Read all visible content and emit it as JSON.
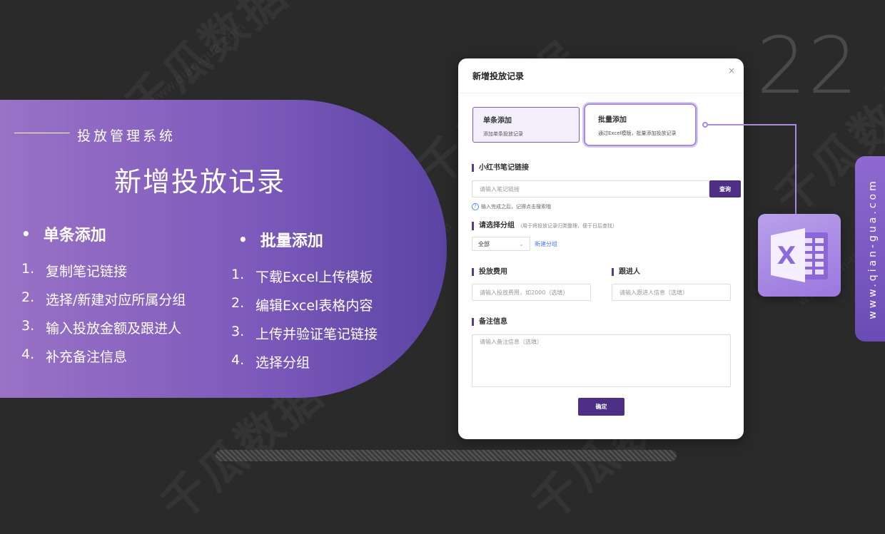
{
  "page_number": "22",
  "watermark": {
    "text": "千瓜数据",
    "url": "www.qian-gua.com"
  },
  "side_tab": {
    "text": "www.qian-gua.com"
  },
  "hero": {
    "subtitle": "投放管理系统",
    "title": "新增投放记录",
    "single": {
      "heading": "单条添加",
      "steps": [
        {
          "n": "1.",
          "text": "复制笔记链接"
        },
        {
          "n": "2.",
          "text": "选择/新建对应所属分组"
        },
        {
          "n": "3.",
          "text": "输入投放金额及跟进人"
        },
        {
          "n": "4.",
          "text": "补充备注信息"
        }
      ]
    },
    "batch": {
      "heading": "批量添加",
      "steps": [
        {
          "n": "1.",
          "text": "下载Excel上传模板"
        },
        {
          "n": "2.",
          "text": "编辑Excel表格内容"
        },
        {
          "n": "3.",
          "text": "上传并验证笔记链接"
        },
        {
          "n": "4.",
          "text": "选择分组"
        }
      ]
    }
  },
  "modal": {
    "title": "新增投放记录",
    "close": "×",
    "cards": [
      {
        "title": "单条添加",
        "desc": "添加单条投放记录"
      },
      {
        "title": "批量添加",
        "desc": "通过Excel模版，批量添加投放记录"
      }
    ],
    "link_label": "小红书笔记链接",
    "link_placeholder": "请输入笔记链接",
    "query_button": "查询",
    "tip": "输入完成之后，记得点击搜索哦",
    "group_label": "请选择分组",
    "group_hint": "（用于将投放记录归类整理，便于日后查找）",
    "group_value": "全部",
    "new_group": "新建分组",
    "cost_label": "投放费用",
    "cost_placeholder": "请输入投放费用，如2000（选填）",
    "follower_label": "跟进人",
    "follower_placeholder": "请输入跟进人信息（选填）",
    "note_label": "备注信息",
    "note_placeholder": "请输入备注信息（选填）",
    "confirm": "确定"
  },
  "excel_icon": {
    "name": "excel-icon",
    "letter": "X",
    "color": "#8c6bd8"
  }
}
